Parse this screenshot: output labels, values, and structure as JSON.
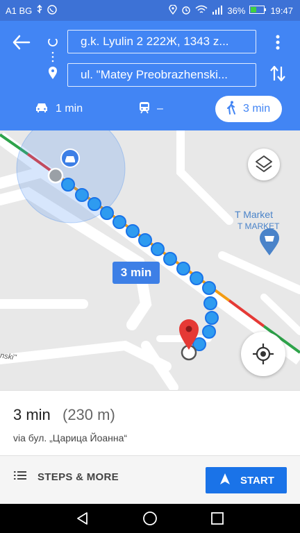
{
  "status_bar": {
    "carrier": "A1 BG",
    "battery": "36%",
    "time": "19:47"
  },
  "header": {
    "origin": "g.k. Lyulin 2 222Ж, 1343 z...",
    "destination": "ul. \"Matey Preobrazhenski...",
    "modes": [
      {
        "name": "car",
        "label": "1 min"
      },
      {
        "name": "transit",
        "label": "–"
      },
      {
        "name": "walk",
        "label": "3 min",
        "selected": true
      }
    ]
  },
  "map": {
    "route_time_chip": "3 min",
    "poi_name": "T Market",
    "poi_subtitle": "T MARKET",
    "street_fragment": "nski\""
  },
  "summary": {
    "duration": "3 min",
    "distance": "(230 m)",
    "via": "via бул. „Царица Йоанна“"
  },
  "actions": {
    "steps_label": "STEPS & MORE",
    "start_label": "START"
  },
  "colors": {
    "header": "#4285f4",
    "route_dot": "#2e9bf0",
    "pin": "#e53935",
    "start": "#1a73e8"
  }
}
